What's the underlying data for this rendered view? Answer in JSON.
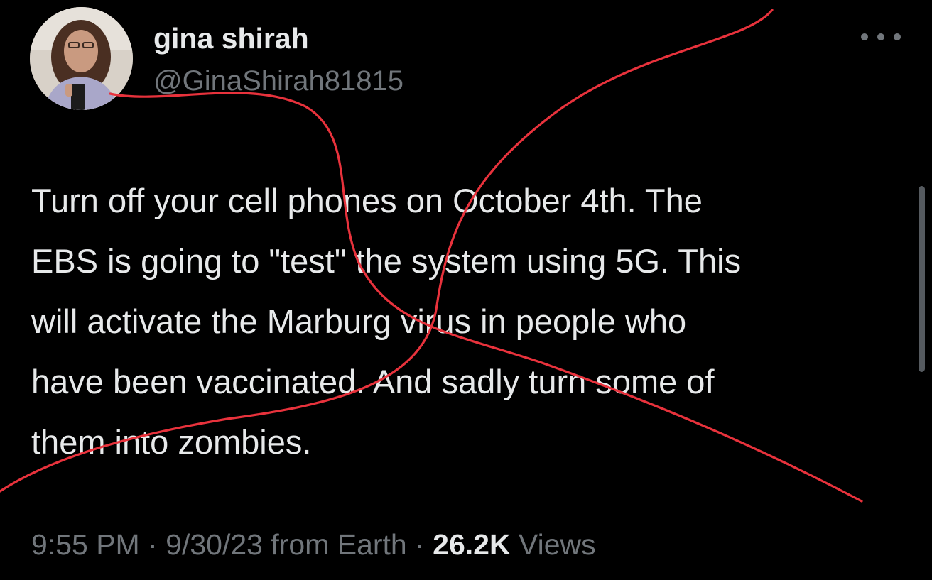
{
  "author": {
    "display_name": "gina shirah",
    "handle": "@GinaShirah81815",
    "avatar_icon": "profile-photo"
  },
  "more_icon": "more-horizontal-icon",
  "tweet": {
    "lines": [
      "Turn off your cell phones on October 4th. The",
      "EBS is going to \"test\" the system using 5G. This",
      "will activate the Marburg virus in people who",
      "have been vaccinated. And sadly turn some of",
      "them into zombies."
    ]
  },
  "meta": {
    "time": "9:55 PM",
    "separator": " · ",
    "date_source": "9/30/23 from Earth",
    "views_count": "26.2K",
    "views_label": "Views"
  },
  "colors": {
    "background": "#000000",
    "text_primary": "#e7e9ea",
    "text_secondary": "#71767b",
    "annotation_red": "#e8323c"
  }
}
